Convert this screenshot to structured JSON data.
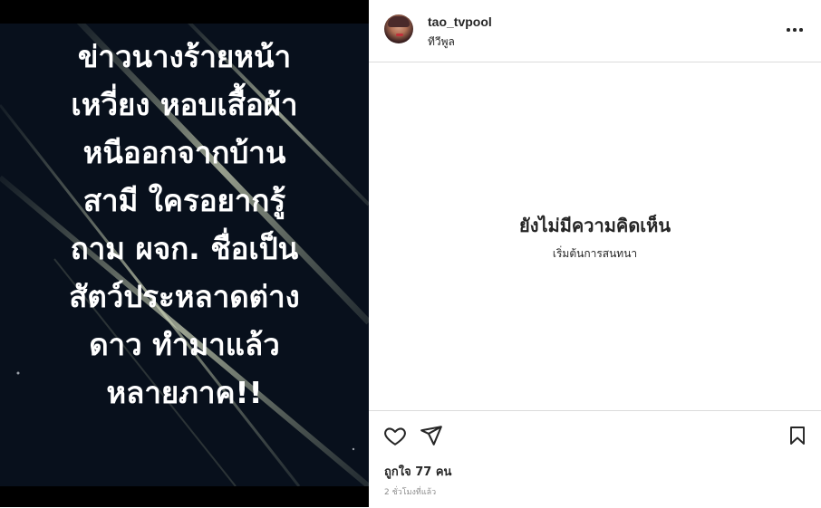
{
  "post": {
    "image_text_lines": [
      "ข่าวนางร้ายหน้า",
      "เหวี่ยง หอบเสื้อผ้า",
      "หนีออกจากบ้าน",
      "สามี ใครอยากรู้",
      "ถาม ผจก. ชื่อเป็น",
      "สัตว์ประหลาดต่าง",
      "ดาว ทำมาแล้ว",
      "หลายภาค!!"
    ]
  },
  "header": {
    "username": "tao_tvpool",
    "location": "ทีวีพูล",
    "more_icon": "more-options-icon"
  },
  "comments": {
    "empty_title": "ยังไม่มีความคิดเห็น",
    "empty_subtitle": "เริ่มต้นการสนทนา"
  },
  "actions": {
    "like_icon": "heart-icon",
    "share_icon": "paper-plane-icon",
    "save_icon": "bookmark-icon",
    "likes_text": "ถูกใจ 77 คน",
    "time_text": "2 ชั่วโมงที่แล้ว"
  },
  "colors": {
    "image_background": "#08101c",
    "text_primary": "#262626",
    "text_secondary": "#8e8e8e",
    "divider": "#dbdbdb"
  }
}
